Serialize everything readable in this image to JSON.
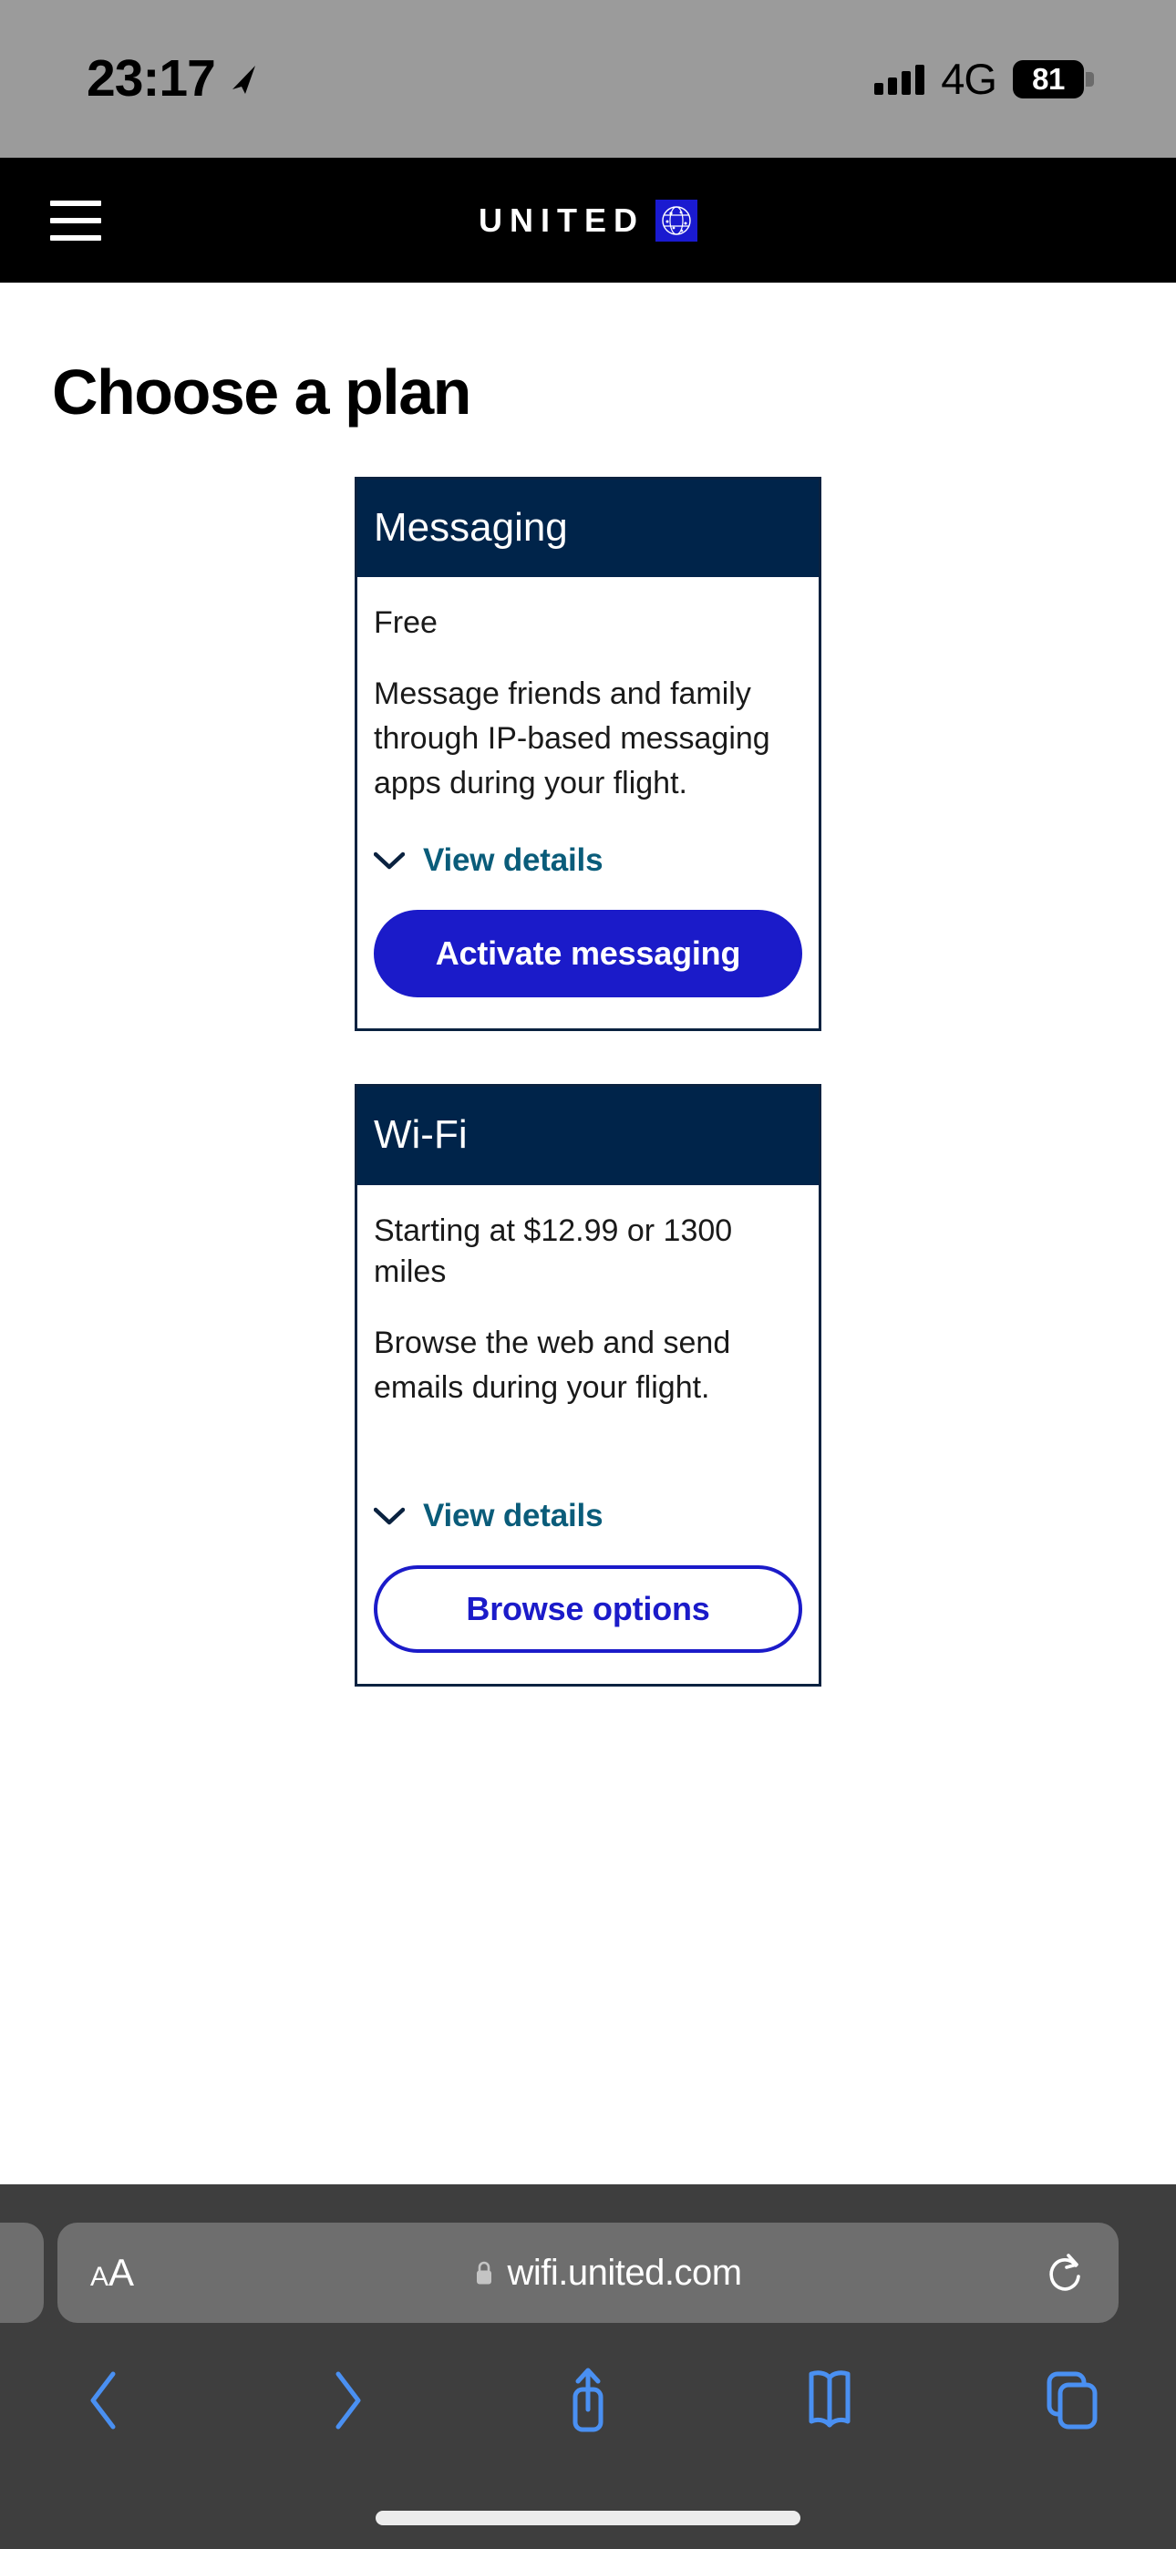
{
  "status_bar": {
    "time": "23:17",
    "location_icon": "location-arrow-icon",
    "signal_icon": "signal-bars-icon",
    "network": "4G",
    "battery_percent": "81",
    "bar_color": "#9b9b9b"
  },
  "site_header": {
    "menu_icon": "hamburger-menu-icon",
    "brand": "UNITED",
    "logo_icon": "united-globe-icon",
    "background": "#000000",
    "logo_blue": "#1a1ad0"
  },
  "page": {
    "title": "Choose a plan"
  },
  "plans": [
    {
      "id": "messaging",
      "title": "Messaging",
      "price": "Free",
      "description": "Message friends and family through IP-based messaging apps during your flight.",
      "details_label": "View details",
      "details_icon": "chevron-down-icon",
      "cta_label": "Activate messaging",
      "cta_style": "primary"
    },
    {
      "id": "wifi",
      "title": "Wi-Fi",
      "price": "Starting at $12.99 or 1300 miles",
      "description": "Browse the web and send emails during your flight.",
      "details_label": "View details",
      "details_icon": "chevron-down-icon",
      "cta_label": "Browse options",
      "cta_style": "outline"
    }
  ],
  "theme": {
    "card_header_navy": "#00244a",
    "card_border_navy": "#0a2240",
    "link_teal": "#0a5c7a",
    "button_blue": "#1b1bc9"
  },
  "browser": {
    "text_size_label_small": "A",
    "text_size_label_large": "A",
    "text_size_icon": "text-size-icon",
    "lock_icon": "lock-icon",
    "url": "wifi.united.com",
    "reload_icon": "reload-icon",
    "toolbar": {
      "back_icon": "back-chevron-icon",
      "forward_icon": "forward-chevron-icon",
      "share_icon": "share-icon",
      "bookmarks_icon": "bookmarks-book-icon",
      "tabs_icon": "tabs-icon"
    },
    "chrome_background": "#3e3e3e",
    "urlbar_background": "#6e6e6e",
    "icon_blue": "#4a90f2"
  }
}
